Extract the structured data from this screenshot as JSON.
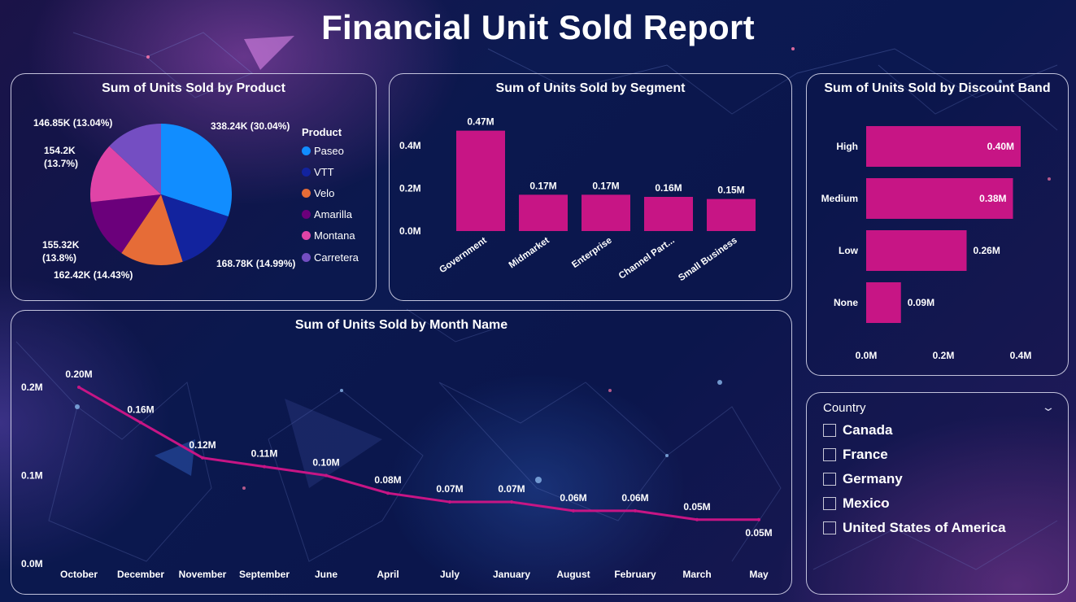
{
  "report": {
    "title": "Financial Unit Sold Report"
  },
  "colors": {
    "accent": "#c71585",
    "background": "#0c1a52",
    "panel_border": "#e1e1f5"
  },
  "product_chart": {
    "title": "Sum of Units Sold by Product",
    "legend_title": "Product",
    "chart_data": {
      "type": "pie",
      "title": "Sum of Units Sold by Product",
      "series": [
        {
          "name": "Paseo",
          "value": 338.24,
          "label": "338.24K (30.04%)",
          "color": "#118dff"
        },
        {
          "name": "VTT",
          "value": 168.78,
          "label": "168.78K (14.99%)",
          "color": "#12239e"
        },
        {
          "name": "Velo",
          "value": 162.42,
          "label": "162.42K (14.43%)",
          "color": "#e66c37"
        },
        {
          "name": "Amarilla",
          "value": 155.32,
          "label": "155.32K (13.8%)",
          "color": "#6b007b"
        },
        {
          "name": "Montana",
          "value": 154.2,
          "label": "154.2K (13.7%)",
          "color": "#e044a7"
        },
        {
          "name": "Carretera",
          "value": 146.85,
          "label": "146.85K (13.04%)",
          "color": "#744ec2"
        }
      ]
    }
  },
  "segment_chart": {
    "title": "Sum of Units Sold by Segment",
    "chart_data": {
      "type": "bar",
      "title": "Sum of Units Sold by Segment",
      "categories": [
        "Government",
        "Midmarket",
        "Enterprise",
        "Channel Part...",
        "Small Business"
      ],
      "values": [
        0.47,
        0.17,
        0.17,
        0.16,
        0.15
      ],
      "data_labels": [
        "0.47M",
        "0.17M",
        "0.17M",
        "0.16M",
        "0.15M"
      ],
      "yticks": [
        "0.0M",
        "0.2M",
        "0.4M"
      ],
      "ylim": [
        0,
        0.5
      ]
    }
  },
  "discount_chart": {
    "title": "Sum of Units Sold by Discount Band",
    "chart_data": {
      "type": "bar",
      "orientation": "horizontal",
      "title": "Sum of Units Sold by Discount Band",
      "categories": [
        "High",
        "Medium",
        "Low",
        "None"
      ],
      "values": [
        0.4,
        0.38,
        0.26,
        0.09
      ],
      "data_labels": [
        "0.40M",
        "0.38M",
        "0.26M",
        "0.09M"
      ],
      "xticks": [
        "0.0M",
        "0.2M",
        "0.4M"
      ],
      "xlim": [
        0,
        0.4
      ]
    }
  },
  "month_chart": {
    "title": "Sum of Units Sold by Month Name",
    "chart_data": {
      "type": "line",
      "title": "Sum of Units Sold by Month Name",
      "categories": [
        "October",
        "December",
        "November",
        "September",
        "June",
        "April",
        "July",
        "January",
        "August",
        "February",
        "March",
        "May"
      ],
      "values": [
        0.2,
        0.16,
        0.12,
        0.11,
        0.1,
        0.08,
        0.07,
        0.07,
        0.06,
        0.06,
        0.05,
        0.05
      ],
      "data_labels": [
        "0.20M",
        "0.16M",
        "0.12M",
        "0.11M",
        "0.10M",
        "0.08M",
        "0.07M",
        "0.07M",
        "0.06M",
        "0.06M",
        "0.05M",
        "0.05M"
      ],
      "yticks": [
        "0.0M",
        "0.1M",
        "0.2M"
      ],
      "ylim": [
        0,
        0.2
      ]
    }
  },
  "country_slicer": {
    "header": "Country",
    "chevron_icon": "chevron-down-icon",
    "items": [
      "Canada",
      "France",
      "Germany",
      "Mexico",
      "United States of America"
    ]
  }
}
